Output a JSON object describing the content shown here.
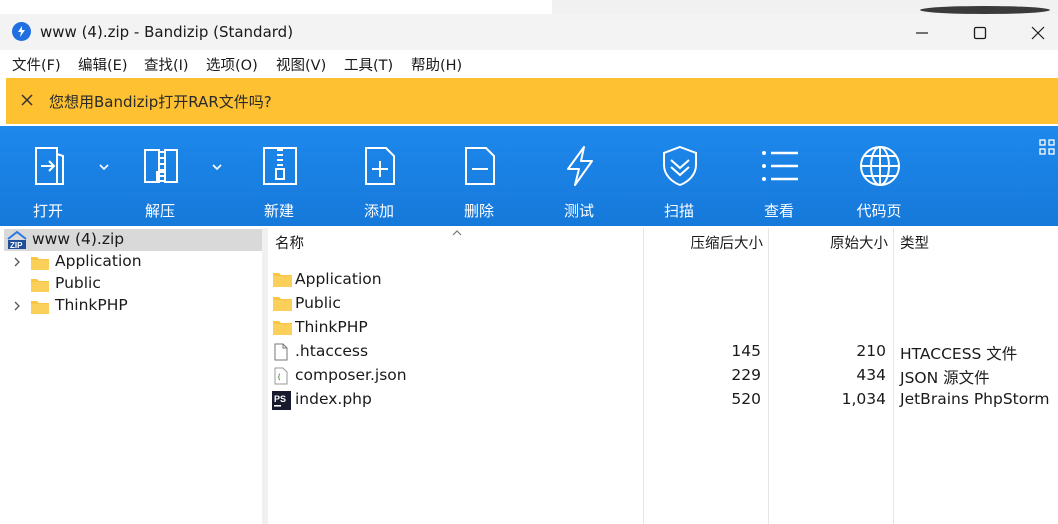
{
  "window": {
    "title": "www (4).zip - Bandizip (Standard)"
  },
  "menu": [
    "文件(F)",
    "编辑(E)",
    "查找(I)",
    "选项(O)",
    "视图(V)",
    "工具(T)",
    "帮助(H)"
  ],
  "notification": {
    "message": "您想用Bandizip打开RAR文件吗?"
  },
  "toolbar": {
    "open": "打开",
    "extract": "解压",
    "new": "新建",
    "add": "添加",
    "delete": "删除",
    "test": "测试",
    "scan": "扫描",
    "view": "查看",
    "codepage": "代码页"
  },
  "tree": {
    "root": "www (4).zip",
    "root_badge": "ZIP",
    "items": [
      "Application",
      "Public",
      "ThinkPHP"
    ]
  },
  "list": {
    "columns": {
      "name": "名称",
      "compressed": "压缩后大小",
      "original": "原始大小",
      "type": "类型"
    },
    "rows": [
      {
        "name": "Application",
        "compressed": "",
        "original": "",
        "type": "",
        "icon": "folder-icon"
      },
      {
        "name": "Public",
        "compressed": "",
        "original": "",
        "type": "",
        "icon": "folder-icon"
      },
      {
        "name": "ThinkPHP",
        "compressed": "",
        "original": "",
        "type": "",
        "icon": "folder-icon"
      },
      {
        "name": ".htaccess",
        "compressed": "145",
        "original": "210",
        "type": "HTACCESS 文件",
        "icon": "file-icon"
      },
      {
        "name": "composer.json",
        "compressed": "229",
        "original": "434",
        "type": "JSON 源文件",
        "icon": "json-file-icon"
      },
      {
        "name": "index.php",
        "compressed": "520",
        "original": "1,034",
        "type": "JetBrains PhpStorm",
        "icon": "phpstorm-icon"
      }
    ],
    "phpstorm_badge": "PS"
  },
  "colors": {
    "toolbar": "#1e88ec",
    "notification": "#fdc131",
    "folder": "#f8c642"
  }
}
